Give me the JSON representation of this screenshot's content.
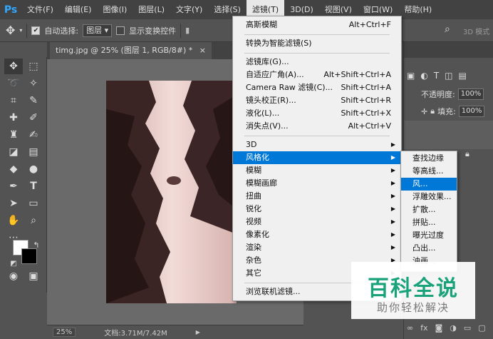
{
  "menubar": {
    "logo": "Ps",
    "items": [
      "文件(F)",
      "编辑(E)",
      "图像(I)",
      "图层(L)",
      "文字(Y)",
      "选择(S)",
      "滤镜(T)",
      "3D(D)",
      "视图(V)",
      "窗口(W)",
      "帮助(H)"
    ],
    "active_index": 6
  },
  "options_bar": {
    "move_icon": "move-icon",
    "auto_select_label": "自动选择:",
    "auto_select_checked": true,
    "auto_select_target": "图层",
    "show_transform_label": "显示变换控件",
    "show_transform_checked": false,
    "mode_3d_label": "3D 模式"
  },
  "document": {
    "tab_title": "timg.jpg @ 25% (图层 1, RGB/8#) *",
    "tab_close": "×",
    "zoom": "25%",
    "doc_info": "文档:3.71M/7.42M"
  },
  "right_panel": {
    "opacity_label": "不透明度:",
    "opacity_value": "100%",
    "fill_label": "填充:",
    "fill_value": "100%"
  },
  "filter_menu": {
    "items": [
      {
        "label": "高斯模糊",
        "shortcut": "Alt+Ctrl+F"
      },
      {
        "label": "转换为智能滤镜(S)",
        "shortcut": ""
      },
      {
        "label": "滤镜库(G)...",
        "shortcut": ""
      },
      {
        "label": "自适应广角(A)...",
        "shortcut": "Alt+Shift+Ctrl+A"
      },
      {
        "label": "Camera Raw 滤镜(C)...",
        "shortcut": "Shift+Ctrl+A"
      },
      {
        "label": "镜头校正(R)...",
        "shortcut": "Shift+Ctrl+R"
      },
      {
        "label": "液化(L)...",
        "shortcut": "Shift+Ctrl+X"
      },
      {
        "label": "消失点(V)...",
        "shortcut": "Alt+Ctrl+V"
      },
      {
        "label": "3D",
        "submenu": true
      },
      {
        "label": "风格化",
        "submenu": true,
        "highlighted": true
      },
      {
        "label": "模糊",
        "submenu": true
      },
      {
        "label": "模糊画廊",
        "submenu": true
      },
      {
        "label": "扭曲",
        "submenu": true
      },
      {
        "label": "锐化",
        "submenu": true
      },
      {
        "label": "视频",
        "submenu": true
      },
      {
        "label": "像素化",
        "submenu": true
      },
      {
        "label": "渲染",
        "submenu": true
      },
      {
        "label": "杂色",
        "submenu": true
      },
      {
        "label": "其它",
        "submenu": true
      },
      {
        "label": "浏览联机滤镜...",
        "shortcut": ""
      }
    ]
  },
  "stylize_menu": {
    "items": [
      {
        "label": "查找边缘"
      },
      {
        "label": "等高线..."
      },
      {
        "label": "风...",
        "highlighted": true
      },
      {
        "label": "浮雕效果..."
      },
      {
        "label": "扩散..."
      },
      {
        "label": "拼贴..."
      },
      {
        "label": "曝光过度"
      },
      {
        "label": "凸出..."
      },
      {
        "label": "油画..."
      }
    ]
  },
  "watermark": {
    "title": "百科全说",
    "subtitle": "助你轻松解决"
  },
  "colors": {
    "accent": "#0078d7",
    "watermark_green": "#1aa37a",
    "ps_blue": "#31a8ff"
  }
}
